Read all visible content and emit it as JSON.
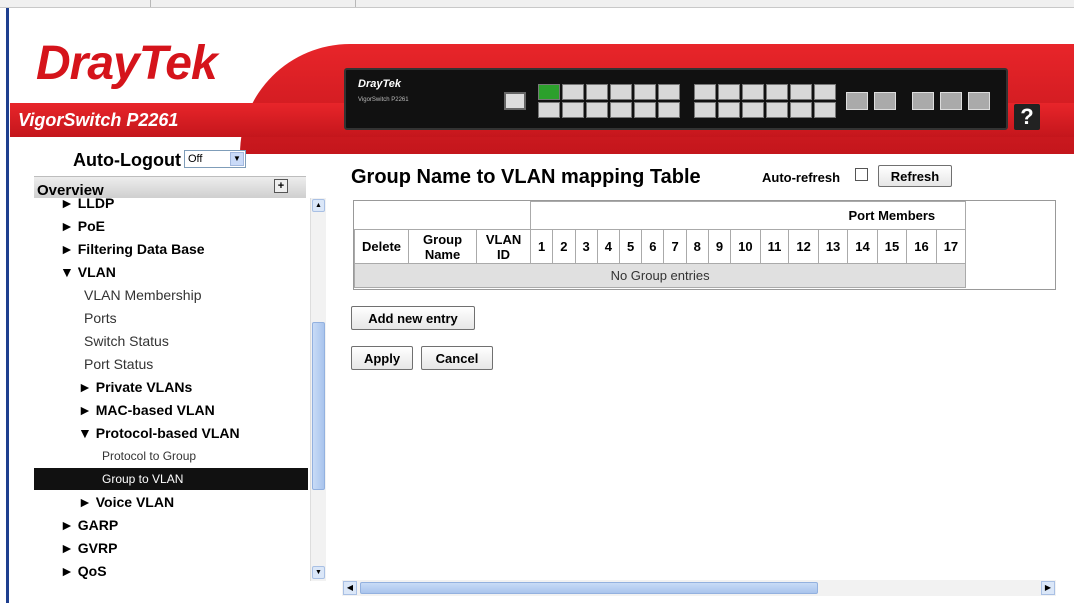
{
  "header": {
    "logo_text": "DrayTek",
    "model": "VigorSwitch P2261",
    "device_brand": "DrayTek",
    "device_model": "VigorSwitch P2261",
    "help_label": "?"
  },
  "sidebar": {
    "auto_logout_label": "Auto-Logout",
    "auto_logout_value": "Off",
    "overview_label": "Overview",
    "items": [
      {
        "label": "► LLDP",
        "level": "l1"
      },
      {
        "label": "► PoE",
        "level": "l1"
      },
      {
        "label": "► Filtering Data Base",
        "level": "l1"
      },
      {
        "label": "▼ VLAN",
        "level": "l1"
      },
      {
        "label": "VLAN Membership",
        "level": "l2"
      },
      {
        "label": "Ports",
        "level": "l2"
      },
      {
        "label": "Switch Status",
        "level": "l2"
      },
      {
        "label": "Port Status",
        "level": "l2"
      },
      {
        "label": "► Private VLANs",
        "level": "l2b"
      },
      {
        "label": "► MAC-based VLAN",
        "level": "l2b"
      },
      {
        "label": "▼ Protocol-based VLAN",
        "level": "l2b"
      },
      {
        "label": "Protocol to Group",
        "level": "l3"
      },
      {
        "label": "Group to VLAN",
        "level": "l3",
        "selected": true
      },
      {
        "label": "► Voice VLAN",
        "level": "l2b"
      },
      {
        "label": "► GARP",
        "level": "l1"
      },
      {
        "label": "► GVRP",
        "level": "l1"
      },
      {
        "label": "► QoS",
        "level": "l1"
      }
    ]
  },
  "main": {
    "title": "Group Name to VLAN mapping Table",
    "auto_refresh_label": "Auto-refresh",
    "auto_refresh_checked": false,
    "refresh_label": "Refresh",
    "table": {
      "port_members_header": "Port Members",
      "col_delete": "Delete",
      "col_group_name": "Group Name",
      "col_vlan_id": "VLAN ID",
      "ports": [
        "1",
        "2",
        "3",
        "4",
        "5",
        "6",
        "7",
        "8",
        "9",
        "10",
        "11",
        "12",
        "13",
        "14",
        "15",
        "16",
        "17"
      ],
      "empty_text": "No Group entries"
    },
    "add_entry_label": "Add new entry",
    "apply_label": "Apply",
    "cancel_label": "Cancel"
  },
  "colors": {
    "brand_red": "#d5141b",
    "selected_bg": "#111111",
    "empty_row_bg": "#e0e0e0"
  }
}
